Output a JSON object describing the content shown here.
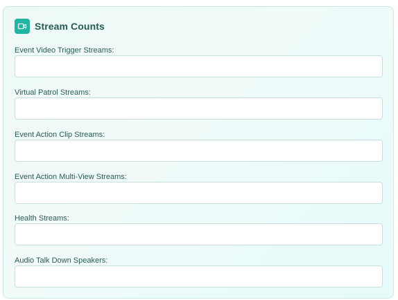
{
  "section": {
    "title": "Stream Counts",
    "icon": "video-camera-icon",
    "accent_color": "#22b5a3"
  },
  "fields": [
    {
      "label": "Event Video Trigger Streams:",
      "value": "",
      "placeholder": ""
    },
    {
      "label": "Virtual Patrol Streams:",
      "value": "",
      "placeholder": ""
    },
    {
      "label": "Event Action Clip Streams:",
      "value": "",
      "placeholder": ""
    },
    {
      "label": "Event Action Multi-View Streams:",
      "value": "",
      "placeholder": ""
    },
    {
      "label": "Health Streams:",
      "value": "",
      "placeholder": ""
    },
    {
      "label": "Audio Talk Down Speakers:",
      "value": "",
      "placeholder": ""
    }
  ]
}
